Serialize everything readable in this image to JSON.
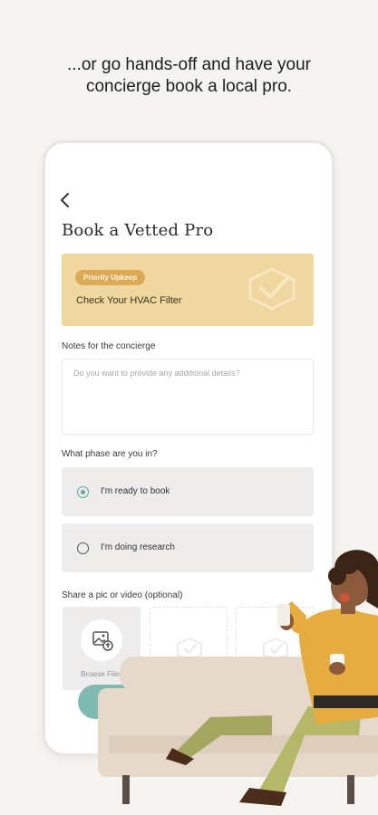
{
  "headline": {
    "line1": "...or go hands-off and have your",
    "line2": "concierge book a local pro."
  },
  "screen": {
    "title": "Book a Vetted Pro",
    "task": {
      "badge": "Priority Upkeep",
      "name": "Check Your HVAC Filter"
    },
    "notes": {
      "label": "Notes for the concierge",
      "placeholder": "Do you want to provide any additional details?"
    },
    "phase": {
      "label": "What phase are you in?",
      "options": [
        {
          "label": "I'm ready to book",
          "selected": true
        },
        {
          "label": "I'm doing research",
          "selected": false
        }
      ]
    },
    "media": {
      "label": "Share a pic or video (optional)",
      "browse_label": "Browse Files"
    }
  },
  "colors": {
    "accent": "#5fa7a0",
    "task_card": "#f0d79f",
    "badge": "#dcaa57",
    "button": "#7fbab3",
    "background": "#f6f4f1"
  },
  "icons": [
    "back-chevron-icon",
    "shield-check-icon",
    "image-upload-icon",
    "radio-selected-icon",
    "radio-unselected-icon"
  ]
}
